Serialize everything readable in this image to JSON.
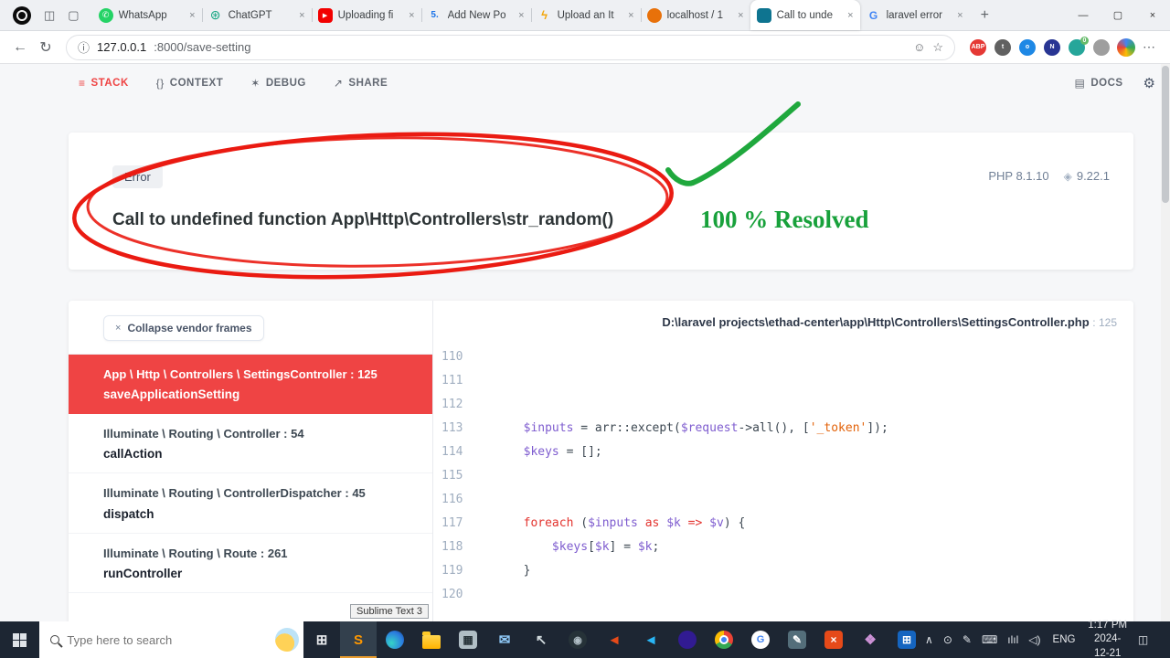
{
  "browser": {
    "ui": {
      "back": "←",
      "reload": "↻",
      "info": "ⓘ",
      "smiley": "☺",
      "star": "☆",
      "menu": "⋯",
      "close_glyph": "×",
      "new_tab": "+",
      "minimize": "—",
      "maximize": "▢",
      "close_window": "×",
      "strip_icon_1": "◫",
      "strip_icon_2": "▢"
    },
    "tabs": [
      {
        "label": "WhatsApp",
        "glyph": "✆"
      },
      {
        "label": "ChatGPT",
        "glyph": "⊛"
      },
      {
        "label": "Uploading fi",
        "glyph": "▶"
      },
      {
        "label": "Add New Po",
        "glyph": "5."
      },
      {
        "label": "Upload an It",
        "glyph": "ϟ"
      },
      {
        "label": "localhost / 1",
        "glyph": ""
      },
      {
        "label": "Call to unde",
        "glyph": "",
        "active": true
      },
      {
        "label": "laravel error",
        "glyph": "G"
      }
    ],
    "address": {
      "host": "127.0.0.1",
      "path": ":8000/save-setting"
    },
    "extensions": [
      {
        "name": "adblock-plus-icon",
        "bg": "#e53935",
        "glyph": "ABP"
      },
      {
        "name": "extension-gray-icon",
        "bg": "#616161",
        "glyph": "t"
      },
      {
        "name": "extension-blue-icon",
        "bg": "#1e88e5",
        "glyph": "o"
      },
      {
        "name": "extension-navy-icon",
        "bg": "#283593",
        "glyph": "N"
      },
      {
        "name": "adguard-icon",
        "bg": "#26a69a",
        "glyph": "",
        "badge": "0"
      },
      {
        "name": "extension-misc-icon",
        "bg": "#9e9e9e",
        "glyph": ""
      }
    ]
  },
  "ignition": {
    "nav": {
      "items": [
        {
          "label": "STACK",
          "glyph": "≡"
        },
        {
          "label": "CONTEXT",
          "glyph": "{}"
        },
        {
          "label": "DEBUG",
          "glyph": "✶"
        },
        {
          "label": "SHARE",
          "glyph": "↗"
        }
      ],
      "docs": "DOCS",
      "docs_glyph": "▤",
      "settings_glyph": "⚙"
    },
    "error": {
      "badge": "Error",
      "message": "Call to undefined function App\\Http\\Controllers\\str_random()",
      "php_version": "PHP 8.1.10",
      "framework_version": "9.22.1",
      "framework_glyph": "◈"
    },
    "stack": {
      "collapse_label": "Collapse vendor frames",
      "collapse_glyph": "×",
      "frames": [
        {
          "klass": "App \\ Http \\ Controllers \\ SettingsController",
          "line": "125",
          "method": "saveApplicationSetting",
          "active": true
        },
        {
          "klass": "Illuminate \\ Routing \\ Controller",
          "line": "54",
          "method": "callAction"
        },
        {
          "klass": "Illuminate \\ Routing \\ ControllerDispatcher",
          "line": "45",
          "method": "dispatch"
        },
        {
          "klass": "Illuminate \\ Routing \\ Route",
          "line": "261",
          "method": "runController"
        }
      ]
    },
    "code": {
      "file_path": "D:\\laravel projects\\ethad-center\\app\\Http\\Controllers\\SettingsController.php",
      "file_line": "125",
      "lines": [
        {
          "no": "110",
          "tokens": []
        },
        {
          "no": "111",
          "tokens": []
        },
        {
          "no": "112",
          "tokens": []
        },
        {
          "no": "113",
          "tokens": [
            {
              "t": "        ",
              "c": "p"
            },
            {
              "t": "$inputs",
              "c": "v"
            },
            {
              "t": " = arr::except(",
              "c": "p"
            },
            {
              "t": "$request",
              "c": "v"
            },
            {
              "t": "->all(), [",
              "c": "p"
            },
            {
              "t": "'_token'",
              "c": "s"
            },
            {
              "t": "]);",
              "c": "p"
            }
          ]
        },
        {
          "no": "114",
          "tokens": [
            {
              "t": "        ",
              "c": "p"
            },
            {
              "t": "$keys",
              "c": "v"
            },
            {
              "t": " = [];",
              "c": "p"
            }
          ]
        },
        {
          "no": "115",
          "tokens": []
        },
        {
          "no": "116",
          "tokens": []
        },
        {
          "no": "117",
          "tokens": [
            {
              "t": "        ",
              "c": "p"
            },
            {
              "t": "foreach",
              "c": "k"
            },
            {
              "t": " (",
              "c": "p"
            },
            {
              "t": "$inputs",
              "c": "v"
            },
            {
              "t": " ",
              "c": "p"
            },
            {
              "t": "as",
              "c": "k"
            },
            {
              "t": " ",
              "c": "p"
            },
            {
              "t": "$k",
              "c": "v"
            },
            {
              "t": " ",
              "c": "p"
            },
            {
              "t": "=>",
              "c": "k"
            },
            {
              "t": " ",
              "c": "p"
            },
            {
              "t": "$v",
              "c": "v"
            },
            {
              "t": ") {",
              "c": "p"
            }
          ]
        },
        {
          "no": "118",
          "tokens": [
            {
              "t": "            ",
              "c": "p"
            },
            {
              "t": "$keys",
              "c": "v"
            },
            {
              "t": "[",
              "c": "p"
            },
            {
              "t": "$k",
              "c": "v"
            },
            {
              "t": "] = ",
              "c": "p"
            },
            {
              "t": "$k",
              "c": "v"
            },
            {
              "t": ";",
              "c": "p"
            }
          ]
        },
        {
          "no": "119",
          "tokens": [
            {
              "t": "        }",
              "c": "p"
            }
          ]
        },
        {
          "no": "120",
          "tokens": []
        }
      ]
    }
  },
  "annotations": {
    "resolved_text": "100 % Resolved"
  },
  "tooltip": {
    "text": "Sublime Text 3"
  },
  "taskbar": {
    "search_placeholder": "Type here to search",
    "language": "ENG",
    "time": "1:17 PM",
    "date": "2024-12-21",
    "action_center_glyph": "◫",
    "apps": [
      {
        "name": "task-view-icon",
        "shape": "plain",
        "glyph": "⊞",
        "fg": "#e8eaed"
      },
      {
        "name": "sublime-text-icon",
        "shape": "plain",
        "glyph": "S",
        "fg": "#ff9800",
        "active": true
      },
      {
        "name": "edge-icon",
        "shape": "edge"
      },
      {
        "name": "file-explorer-icon",
        "shape": "folder"
      },
      {
        "name": "grid-app-icon",
        "shape": "square",
        "glyph": "▦",
        "fg": "#263238",
        "bg": "#b0bec5"
      },
      {
        "name": "mail-icon",
        "shape": "plain",
        "glyph": "✉",
        "fg": "#90caf9"
      },
      {
        "name": "cursor-app-icon",
        "shape": "plain",
        "glyph": "↖",
        "fg": "#cfd8dc"
      },
      {
        "name": "steam-icon",
        "shape": "circle",
        "glyph": "◉",
        "fg": "#b0bec5",
        "bg": "#263238"
      },
      {
        "name": "code-editor-orange-icon",
        "shape": "plain",
        "glyph": "◄",
        "fg": "#e64a19"
      },
      {
        "name": "vscode-icon",
        "shape": "plain",
        "glyph": "◄",
        "fg": "#29b6f6"
      },
      {
        "name": "eclipse-icon",
        "shape": "circle",
        "glyph": "",
        "bg": "#311b92"
      },
      {
        "name": "chrome-icon",
        "shape": "chrome"
      },
      {
        "name": "google-search-app-icon",
        "shape": "circle",
        "glyph": "G",
        "fg": "#4285f4",
        "bg": "#ffffff"
      },
      {
        "name": "pen-app-icon",
        "shape": "square",
        "glyph": "✎",
        "fg": "#ffffff",
        "bg": "#546e7a"
      },
      {
        "name": "orange-x-app-icon",
        "shape": "square",
        "glyph": "×",
        "fg": "#ffffff",
        "bg": "#e64a19"
      },
      {
        "name": "photos-app-icon",
        "shape": "plain",
        "glyph": "❖",
        "fg": "#ce93d8"
      },
      {
        "name": "store-app-icon",
        "shape": "square",
        "glyph": "⊞",
        "fg": "#ffffff",
        "bg": "#1565c0"
      }
    ],
    "tray": [
      {
        "name": "hidden-icons-chevron",
        "glyph": "∧"
      },
      {
        "name": "contact-tray-icon",
        "glyph": "⊙"
      },
      {
        "name": "pen-tray-icon",
        "glyph": "✎"
      },
      {
        "name": "keyboard-tray-icon",
        "glyph": "⌨"
      },
      {
        "name": "network-tray-icon",
        "glyph": "ılıl"
      },
      {
        "name": "volume-tray-icon",
        "glyph": "◁)"
      }
    ]
  }
}
